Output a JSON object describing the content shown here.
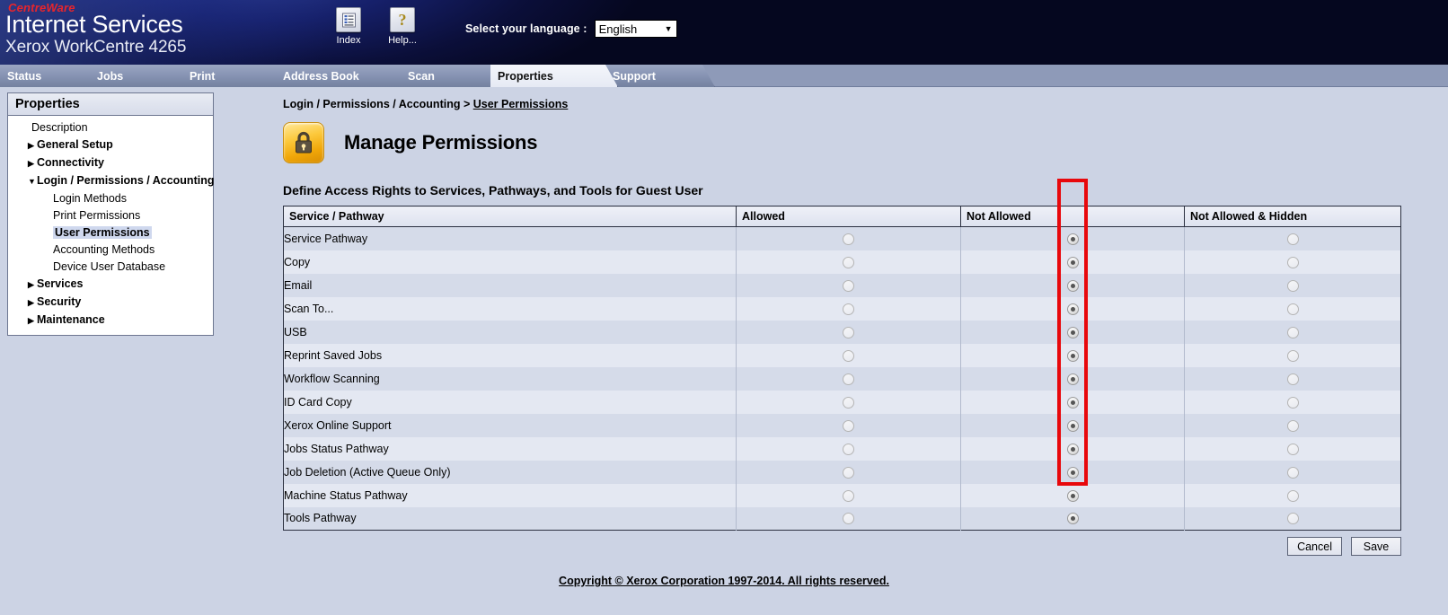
{
  "header": {
    "brand_top": "CentreWare",
    "brand_main": "Internet Services",
    "brand_model": "Xerox WorkCentre 4265",
    "index_icon": "list-icon",
    "index_label": "Index",
    "help_icon": "question-mark-icon",
    "help_label": "Help...",
    "language_label": "Select your language :",
    "language_value": "English",
    "language_options": [
      "English"
    ]
  },
  "tabs": [
    {
      "label": "Status",
      "active": false
    },
    {
      "label": "Jobs",
      "active": false
    },
    {
      "label": "Print",
      "active": false
    },
    {
      "label": "Address Book",
      "active": false
    },
    {
      "label": "Scan",
      "active": false
    },
    {
      "label": "Properties",
      "active": true
    },
    {
      "label": "Support",
      "active": false
    }
  ],
  "sidebar": {
    "title": "Properties",
    "items": [
      {
        "label": "Description",
        "level": 0,
        "marker": "",
        "bold": false,
        "selected": false
      },
      {
        "label": "General Setup",
        "level": 0,
        "marker": "▶",
        "bold": true,
        "selected": false
      },
      {
        "label": "Connectivity",
        "level": 0,
        "marker": "▶",
        "bold": true,
        "selected": false
      },
      {
        "label": "Login / Permissions / Accounting",
        "level": 0,
        "marker": "▼",
        "bold": true,
        "selected": false
      },
      {
        "label": "Login Methods",
        "level": 1,
        "marker": "",
        "bold": false,
        "selected": false
      },
      {
        "label": "Print Permissions",
        "level": 1,
        "marker": "",
        "bold": false,
        "selected": false
      },
      {
        "label": "User Permissions",
        "level": 1,
        "marker": "",
        "bold": true,
        "selected": true
      },
      {
        "label": "Accounting Methods",
        "level": 1,
        "marker": "",
        "bold": false,
        "selected": false
      },
      {
        "label": "Device User Database",
        "level": 1,
        "marker": "",
        "bold": false,
        "selected": false
      },
      {
        "label": "Services",
        "level": 0,
        "marker": "▶",
        "bold": true,
        "selected": false
      },
      {
        "label": "Security",
        "level": 0,
        "marker": "▶",
        "bold": true,
        "selected": false
      },
      {
        "label": "Maintenance",
        "level": 0,
        "marker": "▶",
        "bold": true,
        "selected": false
      }
    ]
  },
  "main": {
    "breadcrumb_parent": "Login / Permissions / Accounting > ",
    "breadcrumb_current": "User Permissions",
    "title_icon": "lock-icon",
    "page_title": "Manage Permissions",
    "section_heading": "Define Access Rights to Services, Pathways, and Tools for Guest User",
    "columns": [
      "Service / Pathway",
      "Allowed",
      "Not Allowed",
      "Not Allowed & Hidden"
    ],
    "rows": [
      {
        "service": "Service Pathway",
        "indent": false,
        "selection": "Not Allowed"
      },
      {
        "service": "Copy",
        "indent": true,
        "selection": "Not Allowed"
      },
      {
        "service": "Email",
        "indent": true,
        "selection": "Not Allowed"
      },
      {
        "service": "Scan To...",
        "indent": true,
        "selection": "Not Allowed"
      },
      {
        "service": "USB",
        "indent": true,
        "selection": "Not Allowed"
      },
      {
        "service": "Reprint Saved Jobs",
        "indent": true,
        "selection": "Not Allowed"
      },
      {
        "service": "Workflow Scanning",
        "indent": true,
        "selection": "Not Allowed"
      },
      {
        "service": "ID Card Copy",
        "indent": true,
        "selection": "Not Allowed"
      },
      {
        "service": "Xerox Online Support",
        "indent": true,
        "selection": "Not Allowed"
      },
      {
        "service": "Jobs Status Pathway",
        "indent": false,
        "selection": "Not Allowed"
      },
      {
        "service": "Job Deletion (Active Queue Only)",
        "indent": true,
        "selection": "Not Allowed"
      },
      {
        "service": "Machine Status Pathway",
        "indent": false,
        "selection": "Not Allowed"
      },
      {
        "service": "Tools Pathway",
        "indent": true,
        "selection": "Not Allowed"
      }
    ],
    "cancel_label": "Cancel",
    "save_label": "Save"
  },
  "highlight": {
    "color": "#e8080c",
    "target_column": "Not Allowed"
  },
  "footer": {
    "copyright": "Copyright © Xerox Corporation 1997-2014. All rights reserved."
  }
}
